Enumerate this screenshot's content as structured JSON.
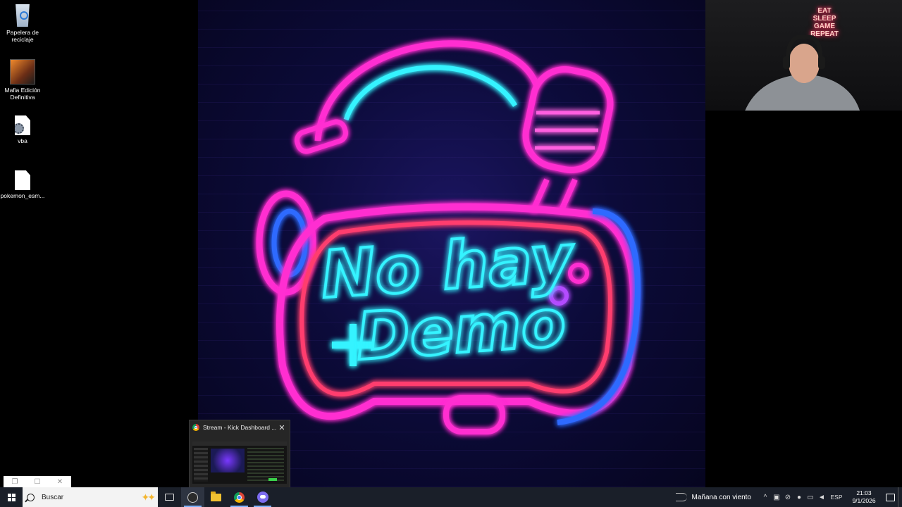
{
  "desktop": {
    "icons": [
      {
        "label": "Papelera de reciclaje",
        "icon": "recycle-bin-icon"
      },
      {
        "label": "Mafia Edición Definitiva",
        "icon": "mafia-game-icon"
      },
      {
        "label": "vba",
        "icon": "settings-file-icon"
      },
      {
        "label": "pokemon_esm...",
        "icon": "file-icon"
      }
    ]
  },
  "wallpaper": {
    "line1": "No hay",
    "line2": "Demo",
    "colors": {
      "pink": "#ff2fd1",
      "cyan": "#35f3ff",
      "blue": "#2e6bff",
      "red": "#ff3d6e",
      "purple": "#b34cff"
    }
  },
  "webcam": {
    "sign": [
      "EAT",
      "SLEEP",
      "GAME",
      "REPEAT"
    ]
  },
  "thumbnail": {
    "title": "Stream - Kick Dashboard ...",
    "icon": "chrome-icon"
  },
  "taskbar": {
    "search_placeholder": "Buscar",
    "apps": [
      {
        "name": "task-view-icon"
      },
      {
        "name": "obs-icon"
      },
      {
        "name": "file-explorer-icon"
      },
      {
        "name": "chrome-icon"
      },
      {
        "name": "discord-icon"
      }
    ],
    "weather": "Mañana con viento",
    "language": "ESP",
    "time": "21:03",
    "date": "9/1/2026"
  }
}
